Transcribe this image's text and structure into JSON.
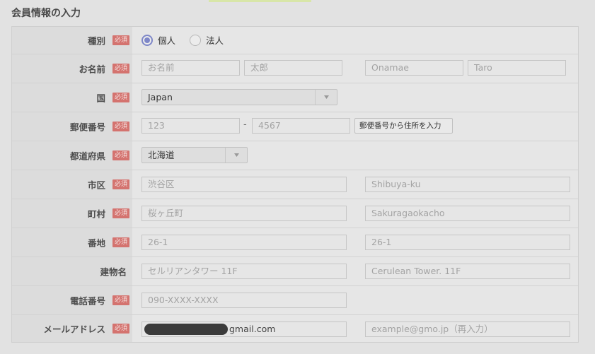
{
  "section_title": "会員情報の入力",
  "required_badge": "必須",
  "rows": {
    "type": {
      "label": "種別",
      "options": [
        "個人",
        "法人"
      ],
      "selected": "個人"
    },
    "name": {
      "label": "お名前",
      "placeholders": [
        "お名前",
        "太郎",
        "Onamae",
        "Taro"
      ]
    },
    "country": {
      "label": "国",
      "value": "Japan"
    },
    "postal": {
      "label": "郵便番号",
      "placeholders": [
        "123",
        "4567"
      ],
      "separator": "-",
      "button_label": "郵便番号から住所を入力"
    },
    "prefecture": {
      "label": "都道府県",
      "value": "北海道"
    },
    "city": {
      "label": "市区",
      "placeholders": [
        "渋谷区",
        "Shibuya-ku"
      ]
    },
    "town": {
      "label": "町村",
      "placeholders": [
        "桜ヶ丘町",
        "Sakuragaokacho"
      ]
    },
    "address": {
      "label": "番地",
      "placeholders": [
        "26-1",
        "26-1"
      ]
    },
    "building": {
      "label": "建物名",
      "placeholders": [
        "セルリアンタワー 11F",
        "Cerulean Tower. 11F"
      ]
    },
    "phone": {
      "label": "電話番号",
      "placeholder": "090-XXXX-XXXX"
    },
    "email": {
      "label": "メールアドレス",
      "value_suffix": "gmail.com",
      "confirm_placeholder": "example@gmo.jp（再入力）"
    }
  },
  "colors": {
    "badge": "#d4736f",
    "radio_checked": "#7e87c8",
    "background": "#e2e2e2"
  }
}
